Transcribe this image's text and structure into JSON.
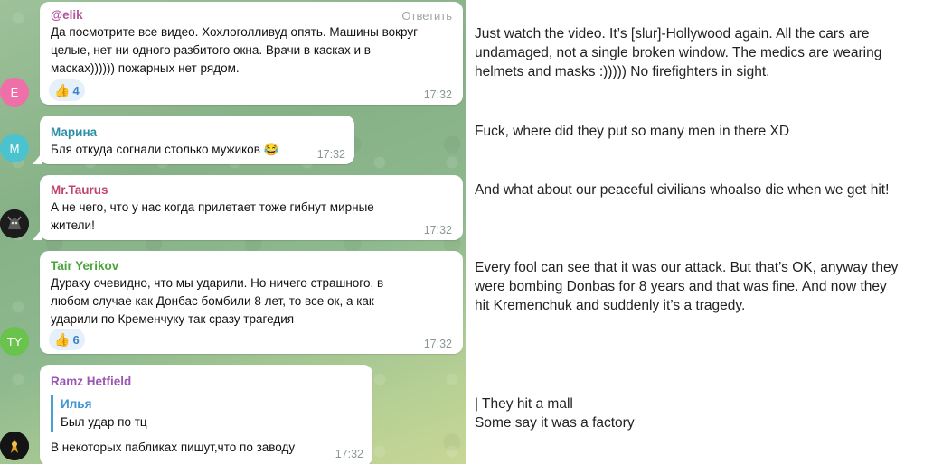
{
  "messages": [
    {
      "author": "@elik",
      "author_color": "#b0579d",
      "action": "Ответить",
      "lines": [
        "Да посмотрите все видео. Хохлоголливуд опять. Машины вокруг",
        "целые, нет ни одного разбитого окна. Врачи в касках и в",
        "масках)))))) пожарных нет рядом."
      ],
      "reaction_count": "4",
      "time": "17:32",
      "avatar_initial": "E",
      "avatar_color": "#ef6fa8"
    },
    {
      "author": "Марина",
      "author_color": "#2d8fa6",
      "lines": [
        "Бля откуда согнали столько мужиков 😂"
      ],
      "time": "17:32",
      "avatar_initial": "M",
      "avatar_color": "#4bc3cf"
    },
    {
      "author": "Mr.Taurus",
      "author_color": "#c0456e",
      "lines": [
        "А не чего, что у нас когда прилетает тоже гибнут мирные",
        "жители!"
      ],
      "time": "17:32"
    },
    {
      "author": "Tair Yerikov",
      "author_color": "#4aa43a",
      "lines": [
        "Дураку очевидно, что мы ударили. Но ничего страшного, в",
        "любом случае как Донбас бомбили 8 лет, то все ок, а как",
        "ударили по Кременчуку так сразу трагедия"
      ],
      "reaction_count": "6",
      "time": "17:32",
      "avatar_initial": "TY",
      "avatar_color": "#6ac34c"
    },
    {
      "author": "Ramz Hetfield",
      "author_color": "#9b56b4",
      "quote_author": "Илья",
      "quote_text": "Был удар по тц",
      "lines": [
        "В некоторых пабликах пишут,что по заводу"
      ],
      "time": "17:32"
    }
  ],
  "translations": [
    [
      "Just watch the video. It’s [slur]-Hollywood again. All the cars are",
      "undamaged, not a single broken window. The medics are wearing",
      "helmets and masks :))))) No firefighters in sight."
    ],
    [
      "Fuck, where did they put so many men in there XD"
    ],
    [
      "And what about our peaceful civilians whoalso die when we get hit!"
    ],
    [
      "Every fool can see that it was our attack. But that’s OK, anyway they",
      "were bombing Donbas for 8 years and that was fine. And now they",
      "hit Kremenchuk and suddenly it’s a tragedy."
    ],
    [
      "| They hit a mall",
      "Some say it was a factory"
    ]
  ],
  "icons": {
    "reaction": "thumbs-up-icon"
  }
}
